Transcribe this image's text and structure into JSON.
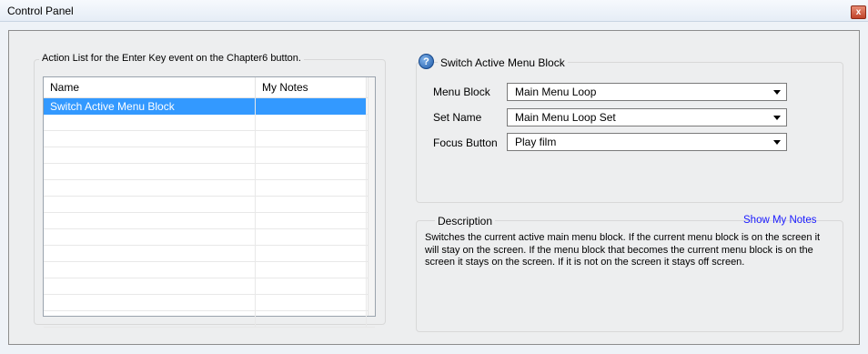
{
  "window": {
    "title": "Control Panel",
    "close_glyph": "x"
  },
  "action_list": {
    "legend": "Action List for the Enter Key event on the Chapter6 button.",
    "columns": [
      "Name",
      "My Notes"
    ],
    "rows": [
      {
        "name": "Switch Active Menu Block",
        "notes": "",
        "selected": true
      }
    ],
    "empty_rows": 13
  },
  "properties": {
    "help_icon": "question-icon",
    "legend": "Switch Active Menu Block",
    "fields": [
      {
        "label": "Menu Block",
        "value": "Main Menu Loop"
      },
      {
        "label": "Set Name",
        "value": "Main Menu Loop Set"
      },
      {
        "label": "Focus Button",
        "value": "Play film"
      }
    ]
  },
  "description": {
    "legend": "Description",
    "show_notes_label": "Show My Notes",
    "text": "Switches the current active main menu block.  If the current menu block is on the screen it will stay on the screen. If the menu block that becomes the current menu block is on the screen it stays on the screen.  If it is not on the screen it stays off screen."
  },
  "colors": {
    "selection": "#3399ff",
    "link": "#1a1aff",
    "close_button": "#c0432a"
  }
}
